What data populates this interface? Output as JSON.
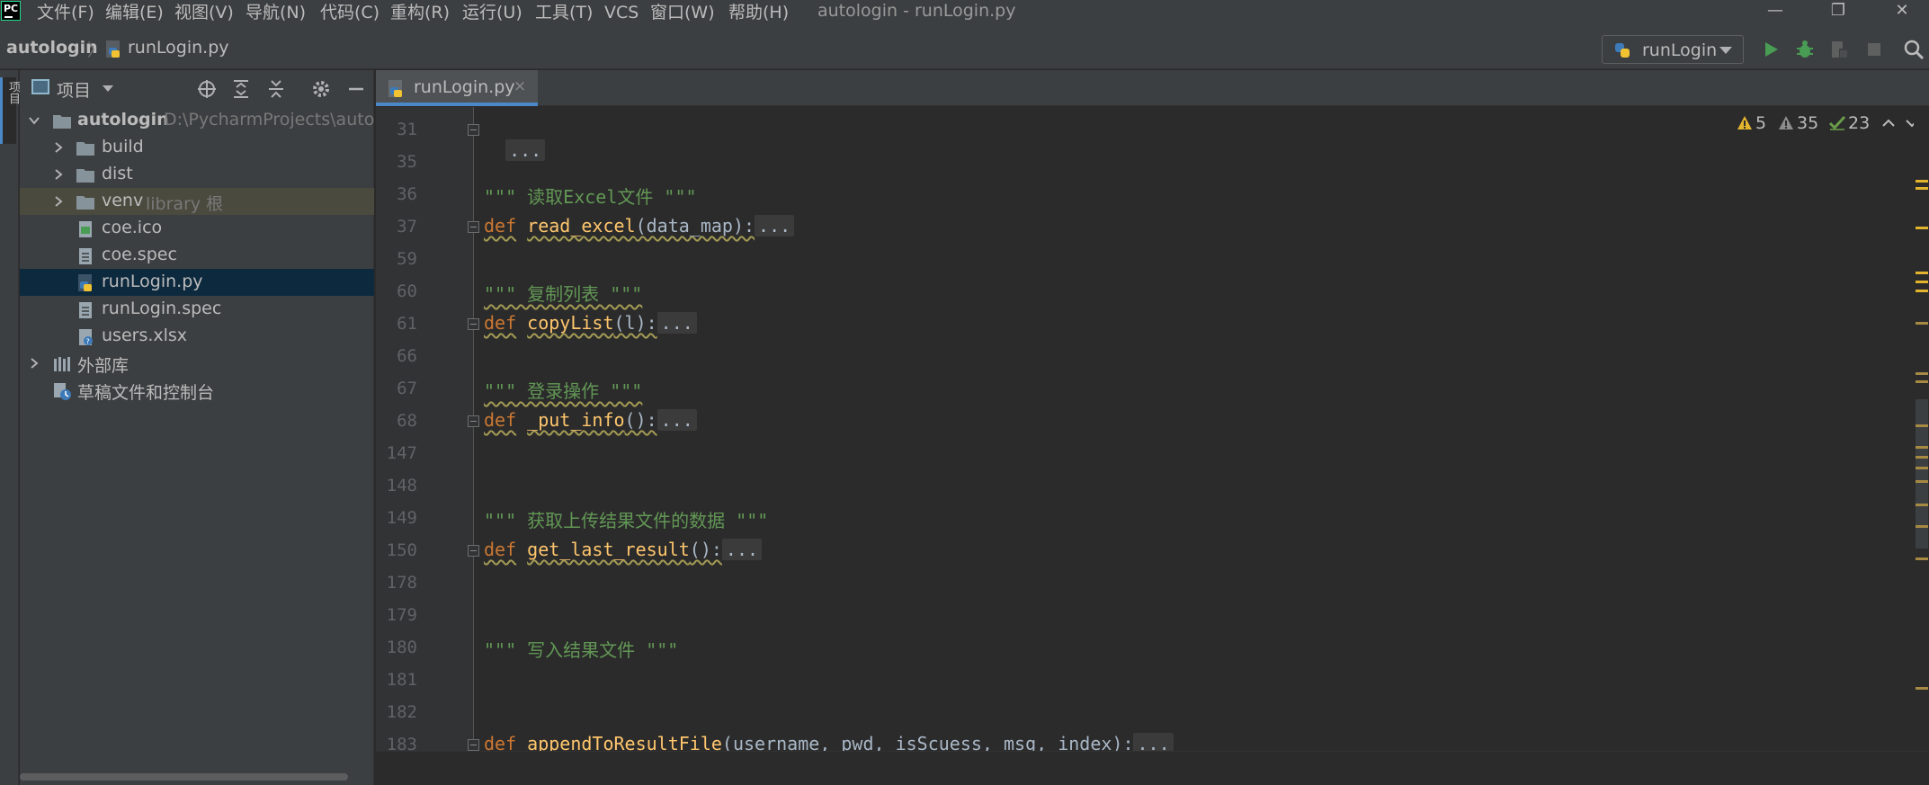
{
  "app": {
    "logo_text": "PC",
    "window_title": "autologin - runLogin.py"
  },
  "menu": [
    {
      "label": "文件(F)"
    },
    {
      "label": "编辑(E)"
    },
    {
      "label": "视图(V)"
    },
    {
      "label": "导航(N)"
    },
    {
      "label": "代码(C)"
    },
    {
      "label": "重构(R)"
    },
    {
      "label": "运行(U)"
    },
    {
      "label": "工具(T)"
    },
    {
      "label": "VCS"
    },
    {
      "label": "窗口(W)"
    },
    {
      "label": "帮助(H)"
    }
  ],
  "window_controls": {
    "minimize": "—",
    "restore": "❐",
    "close": "✕"
  },
  "breadcrumb": {
    "project": "autologin",
    "separator": "〉",
    "file": "runLogin.py"
  },
  "run_config": {
    "label": "runLogin"
  },
  "left_strip": {
    "tab_label": "项目"
  },
  "project_panel": {
    "title": "项目",
    "tree": [
      {
        "label": "autologin",
        "sub": "D:\\PycharmProjects\\autolo"
      },
      {
        "label": "build"
      },
      {
        "label": "dist"
      },
      {
        "label": "venv",
        "sub": "library 根"
      },
      {
        "label": "coe.ico"
      },
      {
        "label": "coe.spec"
      },
      {
        "label": "runLogin.py"
      },
      {
        "label": "runLogin.spec"
      },
      {
        "label": "users.xlsx"
      },
      {
        "label": "外部库"
      },
      {
        "label": "草稿文件和控制台"
      }
    ]
  },
  "editor": {
    "tab_label": "runLogin.py",
    "tab_close": "×",
    "inspections": {
      "warnings": "5",
      "weak_warnings": "35",
      "ok": "23"
    },
    "line_numbers": [
      "31",
      "35",
      "36",
      "37",
      "59",
      "60",
      "61",
      "66",
      "67",
      "68",
      "147",
      "148",
      "149",
      "150",
      "178",
      "179",
      "180",
      "181",
      "182",
      "183"
    ],
    "lines": {
      "l31_fold": "...",
      "l36_doc": "\"\"\" 读取Excel文件 \"\"\"",
      "l37_kw": "def",
      "l37_fn": "read_excel",
      "l37_args": "(data_map):",
      "l37_fold": "...",
      "l60_doc": "\"\"\" 复制列表 \"\"\"",
      "l61_kw": "def",
      "l61_fn": "copyList",
      "l61_args": "(l):",
      "l61_fold": "...",
      "l67_doc": "\"\"\" 登录操作 \"\"\"",
      "l68_kw": "def",
      "l68_fn": "_put_info",
      "l68_args": "():",
      "l68_fold": "...",
      "l149_doc": "\"\"\" 获取上传结果文件的数据 \"\"\"",
      "l150_kw": "def",
      "l150_fn": "get_last_result",
      "l150_args": "():",
      "l150_fold": "...",
      "l180_doc": "\"\"\" 写入结果文件 \"\"\"",
      "l183_kw": "def",
      "l183_fn": "appendToResultFile",
      "l183_args": "(username, pwd, isScuess, msg, index):",
      "l183_fold": "..."
    }
  },
  "colors": {
    "keyword": "#cc7832",
    "function": "#ffc66d",
    "docstring": "#629755",
    "warning": "#e3b42d",
    "weak_warning": "#a3a3a3",
    "ok": "#6a9c4a",
    "accent": "#4a88c7"
  }
}
